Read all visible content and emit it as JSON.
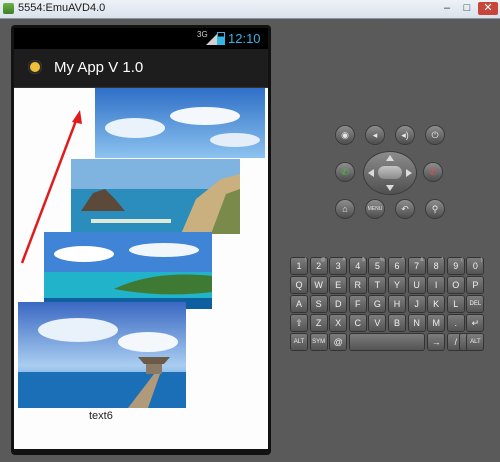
{
  "window": {
    "title": "5554:EmuAVD4.0",
    "min_label": "–",
    "max_label": "□",
    "close_label": "✕"
  },
  "statusbar": {
    "network": "3G",
    "time": "12:10"
  },
  "app": {
    "title": "My App V 1.0"
  },
  "content": {
    "caption": "text6"
  },
  "controls": {
    "row1": [
      "camera-icon",
      "volume-down-icon",
      "volume-up-icon",
      "power-icon"
    ],
    "call_icon": "call-icon",
    "end_call_icon": "end-call-icon",
    "row3": [
      "home-icon",
      "menu-button",
      "back-icon",
      "search-icon"
    ],
    "menu_label": "MENU"
  },
  "keyboard": {
    "row1": [
      {
        "k": "1",
        "s": "!"
      },
      {
        "k": "2",
        "s": "@"
      },
      {
        "k": "3",
        "s": "#"
      },
      {
        "k": "4",
        "s": "$"
      },
      {
        "k": "5",
        "s": "%"
      },
      {
        "k": "6",
        "s": "^"
      },
      {
        "k": "7",
        "s": "&"
      },
      {
        "k": "8",
        "s": "*"
      },
      {
        "k": "9",
        "s": "("
      },
      {
        "k": "0",
        "s": ")"
      }
    ],
    "row2": [
      "Q",
      "W",
      "E",
      "R",
      "T",
      "Y",
      "U",
      "I",
      "O",
      "P"
    ],
    "row3": [
      "A",
      "S",
      "D",
      "F",
      "G",
      "H",
      "J",
      "K",
      "L",
      "DEL"
    ],
    "row4": [
      "⇧",
      "Z",
      "X",
      "C",
      "V",
      "B",
      "N",
      "M",
      ".",
      "↵"
    ],
    "row5": {
      "alt_left": "ALT",
      "sym": "SYM",
      "at": "@",
      "space": "",
      "arrow": "→",
      "slash": "/",
      "comma": ",",
      "alt_right": "ALT"
    }
  },
  "colors": {
    "accent": "#33b5e5",
    "arrow": "#e01b1b",
    "call": "#3aa33a",
    "end_call": "#d63b3b"
  }
}
